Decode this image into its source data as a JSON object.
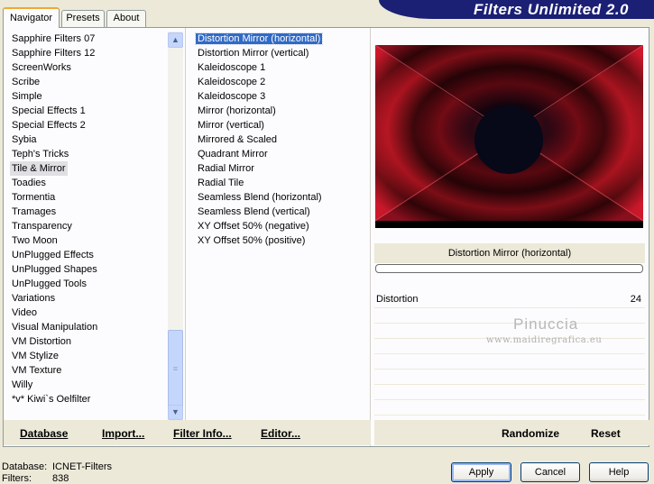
{
  "tabs": [
    {
      "label": "Navigator",
      "active": true
    },
    {
      "label": "Presets",
      "active": false
    },
    {
      "label": "About",
      "active": false
    }
  ],
  "banner": {
    "title": "Filters Unlimited 2.0",
    "color": "#1b2075"
  },
  "categories": [
    "Sapphire Filters 07",
    "Sapphire Filters 12",
    "ScreenWorks",
    "Scribe",
    "Simple",
    "Special Effects 1",
    "Special Effects 2",
    "Sybia",
    "Teph's Tricks",
    "Tile & Mirror",
    "Toadies",
    "Tormentia",
    "Tramages",
    "Transparency",
    "Two Moon",
    "UnPlugged Effects",
    "UnPlugged Shapes",
    "UnPlugged Tools",
    "Variations",
    "Video",
    "Visual Manipulation",
    "VM Distortion",
    "VM Stylize",
    "VM Texture",
    "Willy",
    "*v* Kiwi`s Oelfilter"
  ],
  "selected_category": "Tile & Mirror",
  "filters": [
    "Distortion Mirror (horizontal)",
    "Distortion Mirror (vertical)",
    "Kaleidoscope 1",
    "Kaleidoscope 2",
    "Kaleidoscope 3",
    "Mirror (horizontal)",
    "Mirror (vertical)",
    "Mirrored & Scaled",
    "Quadrant Mirror",
    "Radial Mirror",
    "Radial Tile",
    "Seamless Blend (horizontal)",
    "Seamless Blend (vertical)",
    "XY Offset 50% (negative)",
    "XY Offset 50% (positive)"
  ],
  "selected_filter": "Distortion Mirror (horizontal)",
  "preview": {
    "label": "Distortion Mirror (horizontal)",
    "accent": "#c0141e",
    "center": "#0a0a1e"
  },
  "params": [
    {
      "name": "Distortion",
      "value": "24"
    }
  ],
  "watermark": {
    "name": "Pinuccia",
    "url": "www.maidiregrafica.eu"
  },
  "toolbar": {
    "database": "Database",
    "import": "Import...",
    "filter_info": "Filter Info...",
    "editor": "Editor..."
  },
  "right_toolbar": {
    "randomize": "Randomize",
    "reset": "Reset"
  },
  "status": {
    "database_label": "Database:",
    "database_value": "ICNET-Filters",
    "filters_label": "Filters:",
    "filters_value": "838"
  },
  "buttons": {
    "apply": "Apply",
    "cancel": "Cancel",
    "help": "Help"
  },
  "icons": {
    "scroll_up": "scroll-up-icon",
    "scroll_down": "scroll-down-icon",
    "scroll_thumb": "scroll-grip-icon"
  }
}
